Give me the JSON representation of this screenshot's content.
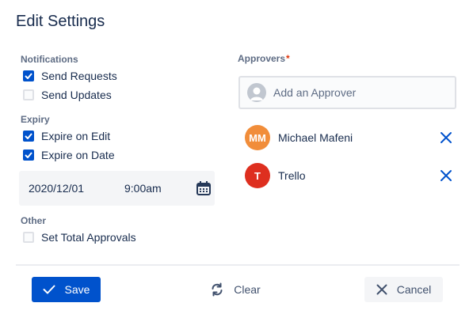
{
  "dialog": {
    "title": "Edit Settings"
  },
  "notifications": {
    "label": "Notifications",
    "options": [
      {
        "label": "Send Requests",
        "checked": true
      },
      {
        "label": "Send Updates",
        "checked": false
      }
    ]
  },
  "expiry": {
    "label": "Expiry",
    "options": [
      {
        "label": "Expire on Edit",
        "checked": true
      },
      {
        "label": "Expire on Date",
        "checked": true
      }
    ],
    "date": "2020/12/01",
    "time": "9:00am",
    "calendar_icon": "calendar-icon"
  },
  "other": {
    "label": "Other",
    "options": [
      {
        "label": "Set Total Approvals",
        "checked": false
      }
    ]
  },
  "approvers": {
    "label": "Approvers",
    "required_marker": "*",
    "placeholder": "Add an Approver",
    "list": [
      {
        "initials": "MM",
        "name": "Michael Mafeni",
        "color": "#f18d3a"
      },
      {
        "initials": "T",
        "name": "Trello",
        "color": "#de2f1f"
      }
    ]
  },
  "footer": {
    "save_label": "Save",
    "clear_label": "Clear",
    "cancel_label": "Cancel"
  },
  "colors": {
    "primary": "#0052cc",
    "remove_icon": "#0052cc",
    "required": "#de350b"
  }
}
